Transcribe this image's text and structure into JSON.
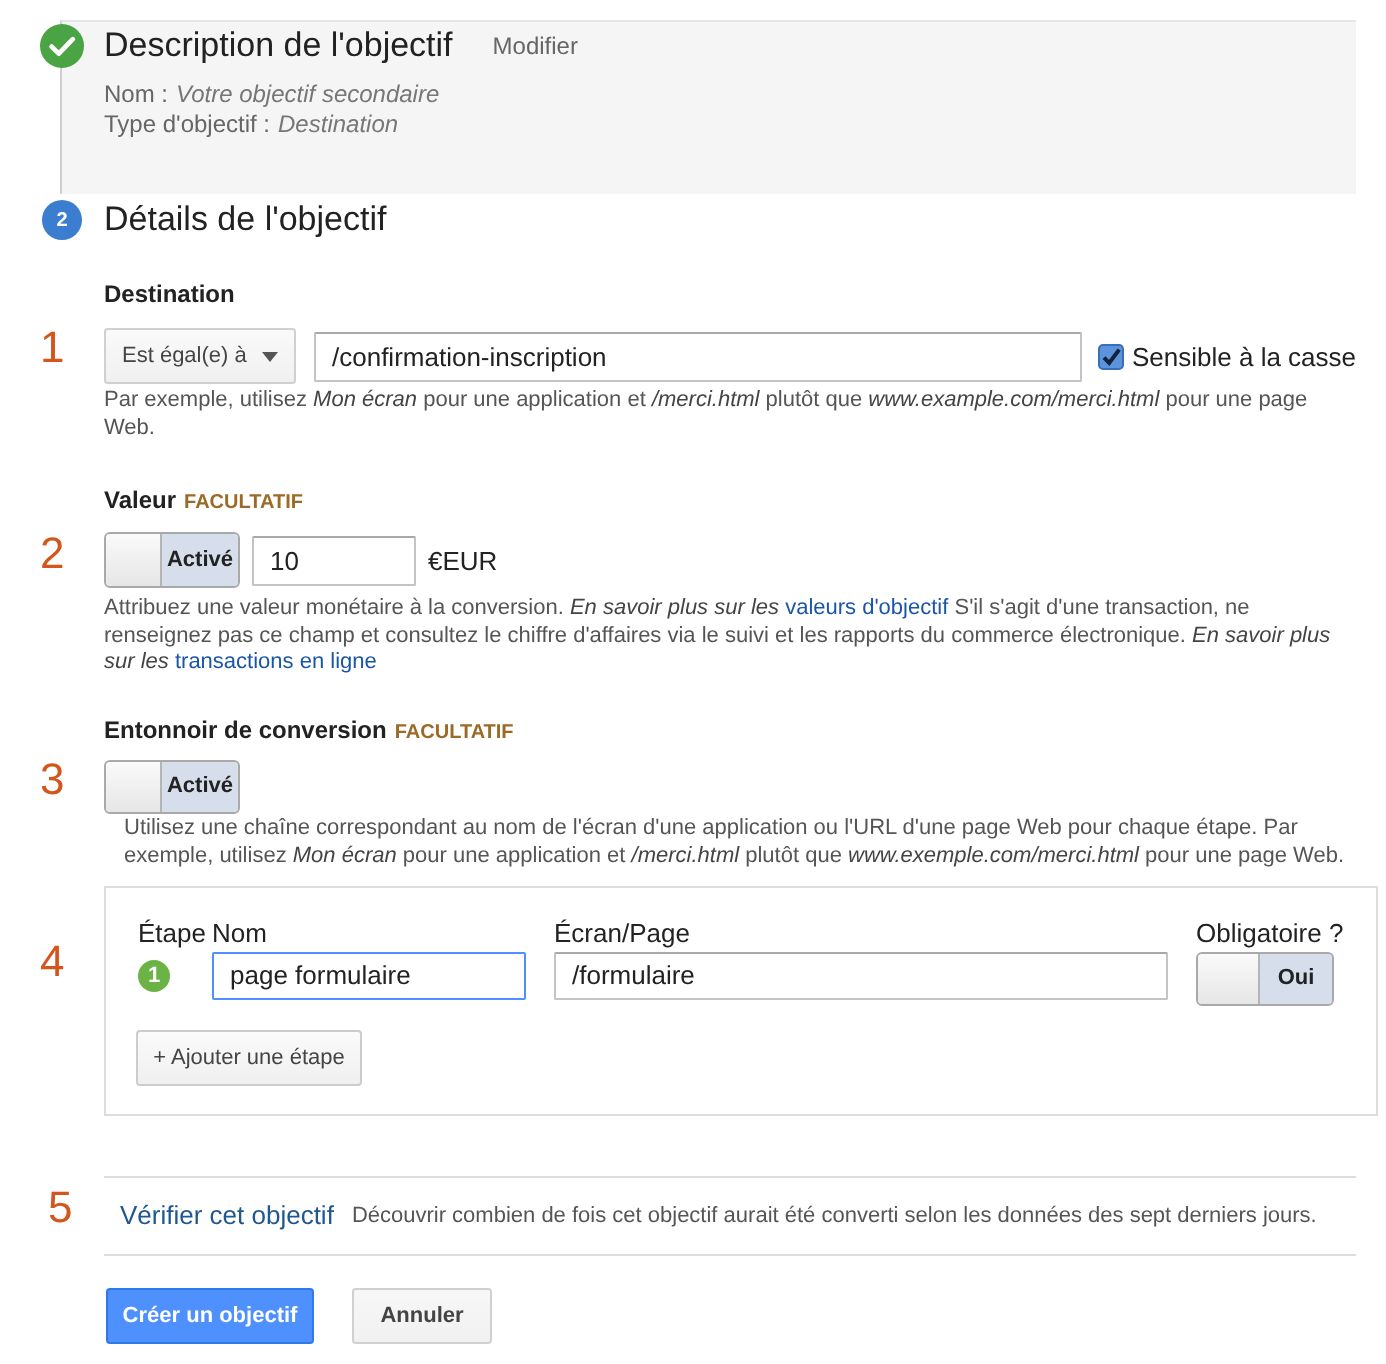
{
  "steps": [
    {
      "kind": "done",
      "title": "Description de l'objectif",
      "action": "Modifier",
      "details": [
        {
          "label": "Nom :",
          "value": "Votre objectif secondaire"
        },
        {
          "label": "Type d'objectif :",
          "value": "Destination"
        }
      ]
    },
    {
      "kind": "current",
      "number": "2",
      "title": "Détails de l'objectif"
    }
  ],
  "destination": {
    "marker": "1",
    "label": "Destination",
    "match_type": "Est égal(e) à",
    "value": "/confirmation-inscription",
    "case_sensitive": {
      "label": "Sensible à la casse",
      "checked": true
    },
    "help": "Par exemple, utilisez *Mon écran* pour une application et */merci.html* plutôt que *www.example.com/merci.html* pour une page Web."
  },
  "value": {
    "marker": "2",
    "label": "Valeur",
    "optional": "FACULTATIF",
    "toggle": {
      "label": "Activé",
      "on": true
    },
    "amount": "10",
    "currency": "€EUR",
    "help": [
      {
        "kind": "text",
        "text": "Attribuez une valeur monétaire à la conversion. *En savoir plus sur les* "
      },
      {
        "kind": "link",
        "text": "valeurs d'objectif"
      },
      {
        "kind": "text",
        "text": " S'il s'agit d'une transaction, ne renseignez pas ce champ et consultez le chiffre d'affaires via le suivi et les rapports du commerce électronique. *En savoir plus sur les* "
      },
      {
        "kind": "link",
        "text": "transactions en ligne"
      }
    ]
  },
  "funnel": {
    "marker": "3",
    "label": "Entonnoir de conversion",
    "optional": "FACULTATIF",
    "toggle": {
      "label": "Activé",
      "on": true
    },
    "help": "Utilisez une chaîne correspondant au nom de l'écran d'une application ou l'URL d'une page Web pour chaque étape. Par exemple, utilisez *Mon écran* pour une application et */merci.html* plutôt que *www.exemple.com/merci.html* pour une page Web.",
    "table_marker": "4",
    "columns": [
      "Étape",
      "Nom",
      "Écran/Page",
      "Obligatoire ?"
    ],
    "rows": [
      {
        "number": "1",
        "name": "page formulaire",
        "name_focused": true,
        "screen": "/formulaire",
        "required": {
          "label": "Oui",
          "on": true
        }
      }
    ],
    "add_button": "+ Ajouter une étape"
  },
  "verify": {
    "marker": "5",
    "link": "Vérifier cet objectif",
    "description": "Découvrir combien de fois cet objectif aurait été converti selon les données des sept derniers jours."
  },
  "buttons": [
    {
      "label": "Créer un objectif",
      "kind": "primary"
    },
    {
      "label": "Annuler",
      "kind": "secondary"
    }
  ]
}
